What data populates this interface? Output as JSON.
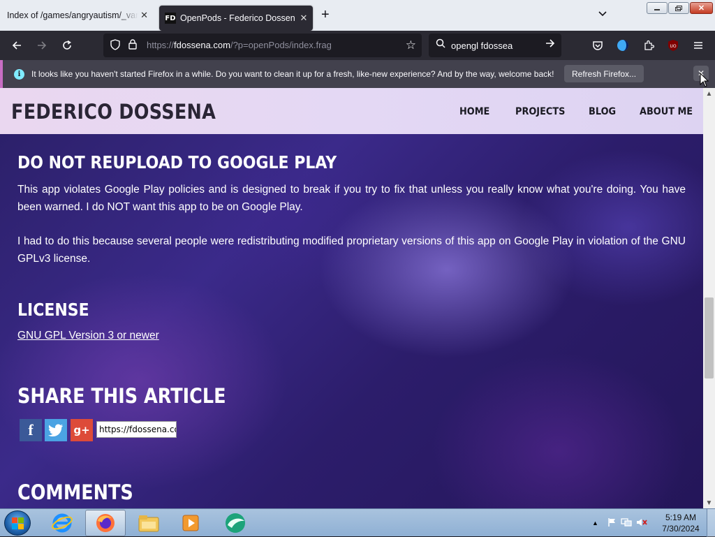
{
  "browser": {
    "tabs": [
      {
        "title": "Index of /games/angryautism/_vanilla",
        "active": false
      },
      {
        "title": "OpenPods - Federico Dossena",
        "active": true,
        "favicon": "FD"
      }
    ],
    "url_prefix": "https://",
    "url_domain": "fdossena.com",
    "url_path": "/?p=openPods/index.frag",
    "search_text": "opengl fdossea",
    "notification": {
      "message": "It looks like you haven't started Firefox in a while. Do you want to clean it up for a fresh, like-new experience? And by the way, welcome back!",
      "button": "Refresh Firefox..."
    },
    "addon_badge": "UO"
  },
  "site": {
    "name": "FEDERICO DOSSENA",
    "menu": [
      "HOME",
      "PROJECTS",
      "BLOG",
      "ABOUT ME"
    ]
  },
  "article": {
    "warning_heading": "DO NOT REUPLOAD TO GOOGLE PLAY",
    "warning_p1": "This app violates Google Play policies and is designed to break if you try to fix that unless you really know what you're doing. You have been warned. I do NOT want this app to be on Google Play.",
    "warning_p2": "I had to do this because several people were redistributing modified proprietary versions of this app on Google Play in violation of the GNU GPLv3 license.",
    "license_heading": "LICENSE",
    "license_link": "GNU GPL Version 3 or newer",
    "share_heading": "SHARE THIS ARTICLE",
    "share_url": "https://fdossena.com/?p=openPods/index.frag",
    "share_icons": {
      "facebook": "f",
      "twitter": "t",
      "googleplus": "g+"
    },
    "comments_heading": "COMMENTS"
  },
  "taskbar": {
    "time": "5:19 AM",
    "date": "7/30/2024"
  }
}
